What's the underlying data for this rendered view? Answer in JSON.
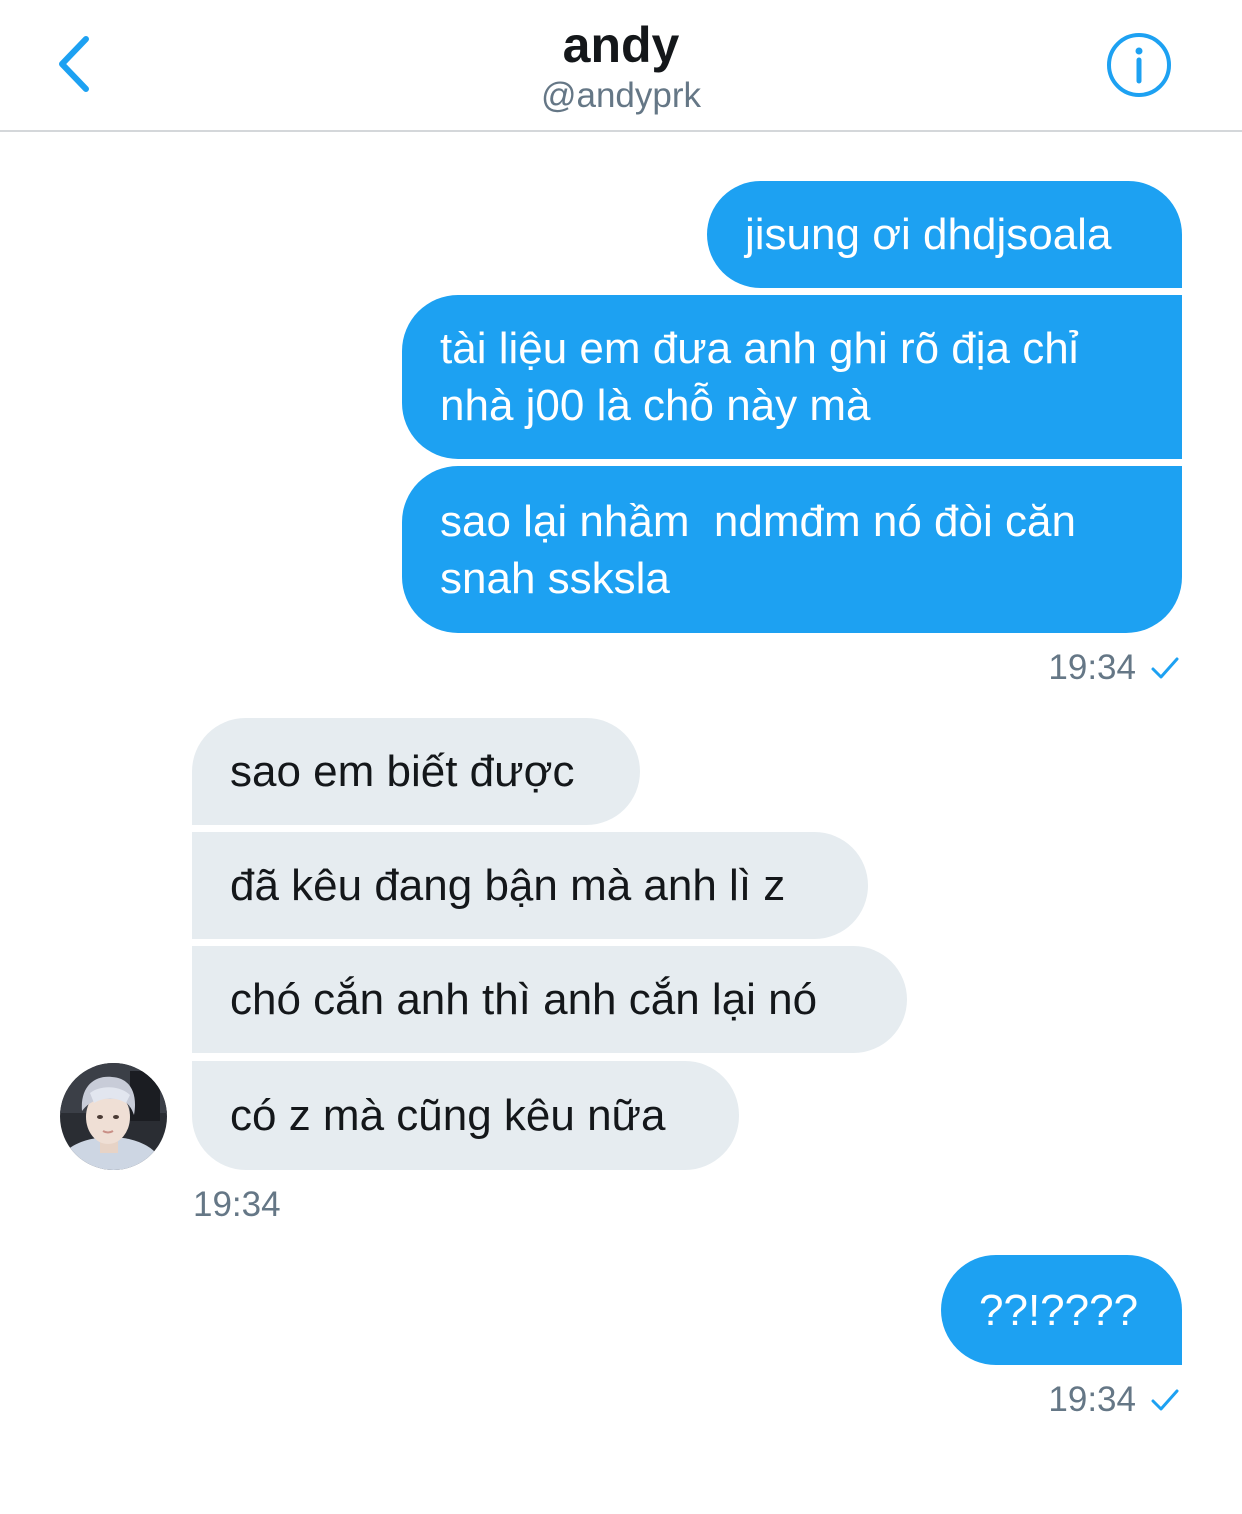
{
  "header": {
    "title": "andy",
    "handle": "@andyprk",
    "back_icon": "chevron-left-icon",
    "info_icon": "info-circle-icon",
    "accent_color": "#1da1f2"
  },
  "messages": [
    {
      "direction": "outgoing",
      "lines": [
        "jisung ơi dhdjsoala"
      ]
    },
    {
      "direction": "outgoing",
      "lines": [
        "tài liệu em đưa anh ghi rõ địa chỉ",
        "nhà j00 là chỗ này mà"
      ]
    },
    {
      "direction": "outgoing",
      "lines": [
        "sao lại nhầm  ndmđm nó đòi căn",
        "snah ssksla"
      ]
    },
    {
      "direction": "incoming",
      "lines": [
        "sao em biết được"
      ]
    },
    {
      "direction": "incoming",
      "lines": [
        "đã kêu đang bận mà anh lì z"
      ]
    },
    {
      "direction": "incoming",
      "lines": [
        "chó cắn anh thì anh cắn lại nó"
      ]
    },
    {
      "direction": "incoming",
      "lines": [
        "có z mà cũng kêu nữa"
      ]
    },
    {
      "direction": "outgoing",
      "lines": [
        "??!????"
      ]
    }
  ],
  "timestamps": {
    "group1": "19:34",
    "group2": "19:34",
    "group3": "19:34"
  },
  "status_icon": "checkmark-icon",
  "colors": {
    "outgoing_bubble": "#1da1f2",
    "incoming_bubble": "#e6ecf0",
    "meta_text": "#657786"
  }
}
